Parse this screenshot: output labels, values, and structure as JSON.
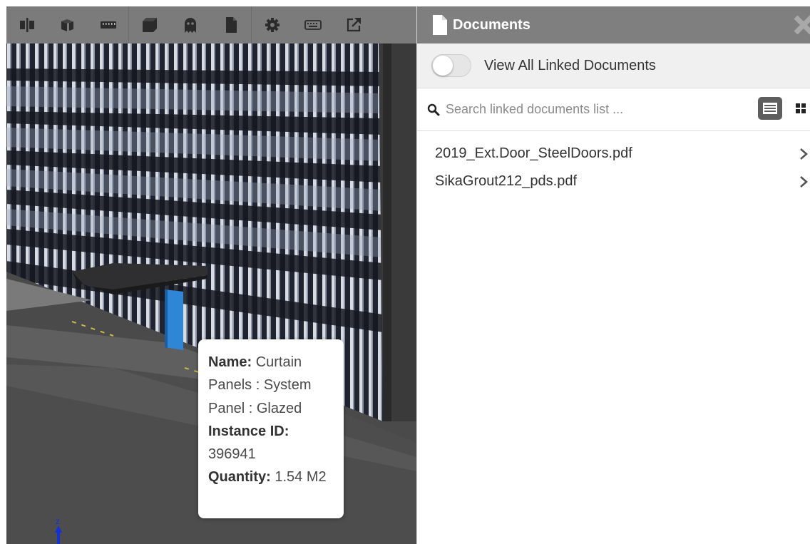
{
  "toolbar": {
    "buttons": [
      {
        "icon": "section-plane-icon"
      },
      {
        "icon": "cube-view-icon"
      },
      {
        "icon": "measure-ruler-icon"
      },
      {
        "icon": "solid-box-icon"
      },
      {
        "icon": "ghost-icon"
      },
      {
        "icon": "document-icon"
      },
      {
        "icon": "gear-icon"
      },
      {
        "icon": "keyboard-icon"
      },
      {
        "icon": "external-link-icon"
      }
    ]
  },
  "tooltip": {
    "name_label": "Name:",
    "name_value": "Curtain Panels : System Panel : Glazed",
    "instance_label": "Instance ID:",
    "instance_value": "396941",
    "quantity_label": "Quantity:",
    "quantity_value": "1.54 M2"
  },
  "axis": {
    "z_label": "z"
  },
  "panel": {
    "title": "Documents",
    "toggle_label": "View All Linked Documents",
    "toggle_on": false,
    "search_placeholder": "Search linked documents list ...",
    "documents": [
      {
        "name": "2019_Ext.Door_SteelDoors.pdf"
      },
      {
        "name": "SikaGrout212_pds.pdf"
      }
    ]
  },
  "colors": {
    "toolbar_bg": "#7b7b7b",
    "header_bg": "#7f7f7f",
    "selected_panel_blue": "#2f86d6"
  }
}
